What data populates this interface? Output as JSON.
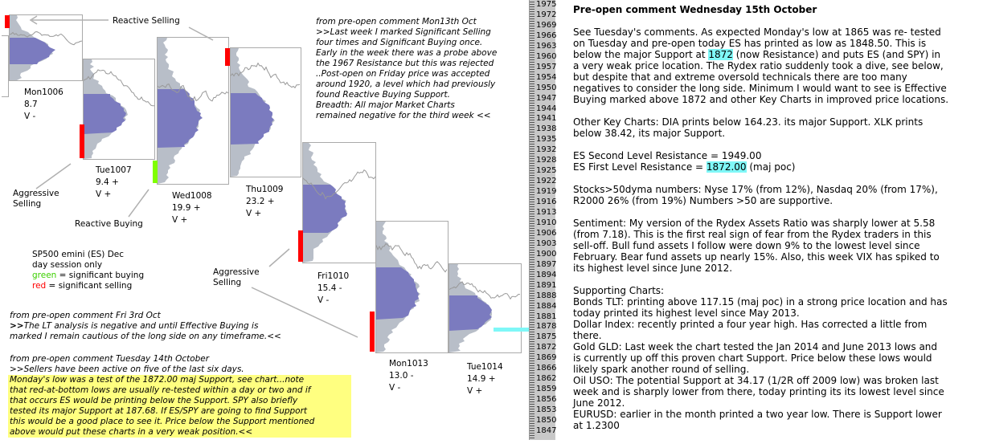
{
  "chart": {
    "annotations": {
      "reactive_selling": "Reactive Selling",
      "aggressive_selling_1": [
        "Aggressive",
        "Selling"
      ],
      "reactive_buying": "Reactive Buying",
      "aggressive_selling_2": [
        "Aggressive",
        "Selling"
      ]
    },
    "days": [
      {
        "name": "Mon1006",
        "value": "8.7",
        "vol": "V -",
        "marker": "red"
      },
      {
        "name": "Tue1007",
        "value": "9.4 +",
        "vol": "V +",
        "marker": "red"
      },
      {
        "name": "Wed1008",
        "value": "19.9 +",
        "vol": "V +",
        "marker": "green"
      },
      {
        "name": "Thu1009",
        "value": "23.2 +",
        "vol": "V +",
        "marker": "red"
      },
      {
        "name": "Fri1010",
        "value": "15.4 -",
        "vol": "V -",
        "marker": "red"
      },
      {
        "name": "Mon1013",
        "value": "13.0 -",
        "vol": "V -",
        "marker": "red"
      },
      {
        "name": "Tue1014",
        "value": "14.9 +",
        "vol": "V +",
        "marker": "none"
      }
    ],
    "legend": {
      "line1": "SP500 emini  (ES)  Dec",
      "line2": "day session only",
      "green_word": "green",
      "green_rest": " = significant buying",
      "red_word": "red",
      "red_rest": " = significant selling"
    },
    "axis_ticks": [
      "1975",
      "1972",
      "1969",
      "1966",
      "1963",
      "1960",
      "1957",
      "1954",
      "1950",
      "1947",
      "1944",
      "1941",
      "1938",
      "1935",
      "1932",
      "1928",
      "1925",
      "1922",
      "1919",
      "1916",
      "1913",
      "1910",
      "1906",
      "1903",
      "1900",
      "1897",
      "1894",
      "1891",
      "1888",
      "1884",
      "1881",
      "1878",
      "1875",
      "1872",
      "1869",
      "1866",
      "1862",
      "1859",
      "1856",
      "1853",
      "1850",
      "1847"
    ],
    "colors": {
      "significant_buying": "#80ff00",
      "significant_selling": "#ff0000",
      "value_area": "#7b7bbf",
      "profile": "#b8bec8",
      "poc_line": "#7ff7f7",
      "highlight": "#ffff80"
    }
  },
  "left_notes": {
    "mon13": [
      "from pre-open comment Mon13th Oct",
      ">>Last week I marked Significant Selling",
      "four times and Significant Buying once.",
      "Early in the week there was a probe above",
      "the 1967 Resistance but this was rejected",
      "..Post-open on Friday price was accepted",
      "around 1920, a level which had previously",
      "found Reactive Buying Support.",
      "Breadth: All major Market Charts",
      "remained negative for the third week <<"
    ],
    "fri3": {
      "header": "from pre-open comment Fri 3rd Oct",
      "prefix": ">>",
      "line1": "The LT analysis is negative and until Effective Buying is",
      "line2": "marked I remain cautious of the long side on any timeframe.<<"
    },
    "tue14": {
      "header": "from pre-open comment Tuesday 14th October",
      "line1": ">>Sellers have been active on five of the last six days.",
      "highlighted": [
        "Monday's low was a test of the 1872.00 maj Support, see chart...note",
        "that red-at-bottom lows are usually re-tested within a day or two and if",
        "that occurs ES would be printing below the Support. SPY also briefly",
        "tested its major Support at 187.68.   If ES/SPY are going to find Support",
        "this would be a good place to see it.  Price below the Support mentioned",
        "above would put these charts in a very weak position.<<"
      ]
    }
  },
  "right_comment": {
    "title": "Pre-open comment Wednesday 15th October",
    "p1": [
      "See Tuesday's comments. As expected Monday's low at 1865 was re- tested",
      "on Tuesday and pre-open today ES has printed as low as 1848.50.  This is",
      {
        "pre": "below the major Support at ",
        "hl": "1872",
        "post": " (now Resistance) and puts ES (and SPY) in"
      },
      "a very weak price location. The Rydex ratio suddenly took a dive, see below,",
      "but despite that and extreme oversold technicals there are too many",
      "negatives to consider the long side. Minimum I would want to see is Effective",
      "Buying marked above 1872 and other Key Charts in improved price locations."
    ],
    "p2": [
      "Other Key Charts: DIA prints below 164.23. its major Support.  XLK prints",
      "below 38.42, its major Support."
    ],
    "p3": [
      "ES Second Level Resistance = 1949.00",
      {
        "pre": "ES First Level Resistance = ",
        "hl": "1872.00",
        "post": " (maj poc)"
      }
    ],
    "p4": [
      "Stocks>50dyma numbers: Nyse 17% (from 12%), Nasdaq 20% (from 17%),",
      "R2000 26% (from 19%)  Numbers >50 are supportive."
    ],
    "p5": [
      "Sentiment: My version of the Rydex Assets Ratio was sharply lower at 5.58",
      "(from 7.18).  This is the first real sign of fear from the Rydex traders in this",
      "sell-off.  Bull fund assets I follow were down 9% to the lowest level since",
      "February. Bear fund assets up nearly 15%.  Also, this week VIX has spiked to",
      "its highest level since June 2012."
    ],
    "p6": [
      "Supporting Charts:",
      "Bonds TLT: printing above 117.15 (maj poc) in a strong price location and has",
      "today printed its highest level since May 2013.",
      "Dollar Index: recently printed a four year high. Has corrected a little from",
      "there.",
      "Gold GLD: Last week the chart tested the Jan 2014 and June 2013 lows and",
      "is currently up off this proven chart Support.  Price below these lows would",
      "likely spark another round of selling.",
      "Oil USO: The potential Support at 34.17 (1/2R off 2009 low) was broken last",
      "week and is sharply lower from there, today printing its its lowest level since",
      "June 2012.",
      "EURUSD: earlier in the month printed a two year low.  There is Support lower",
      "at 1.2300"
    ]
  }
}
